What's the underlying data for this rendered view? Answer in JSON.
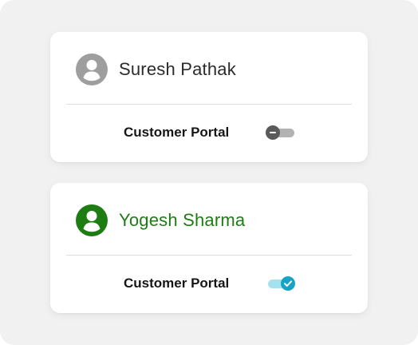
{
  "cards": [
    {
      "name": "Suresh Pathak",
      "name_color": "#2b2b2b",
      "avatar_color": "#9e9e9e",
      "avatar_icon": "user-circle-icon",
      "toggle_label": "Customer Portal",
      "toggle_state": "off",
      "toggle_icon": "minus-icon",
      "toggle_track_color": "#b3b3b3",
      "toggle_knob_color": "#5a5a5a"
    },
    {
      "name": "Yogesh Sharma",
      "name_color": "#1d7d12",
      "avatar_color": "#1d7d12",
      "avatar_icon": "user-circle-icon",
      "toggle_label": "Customer Portal",
      "toggle_state": "on",
      "toggle_icon": "check-icon",
      "toggle_track_color": "#a6e2ee",
      "toggle_knob_color": "#16a3c4"
    }
  ]
}
